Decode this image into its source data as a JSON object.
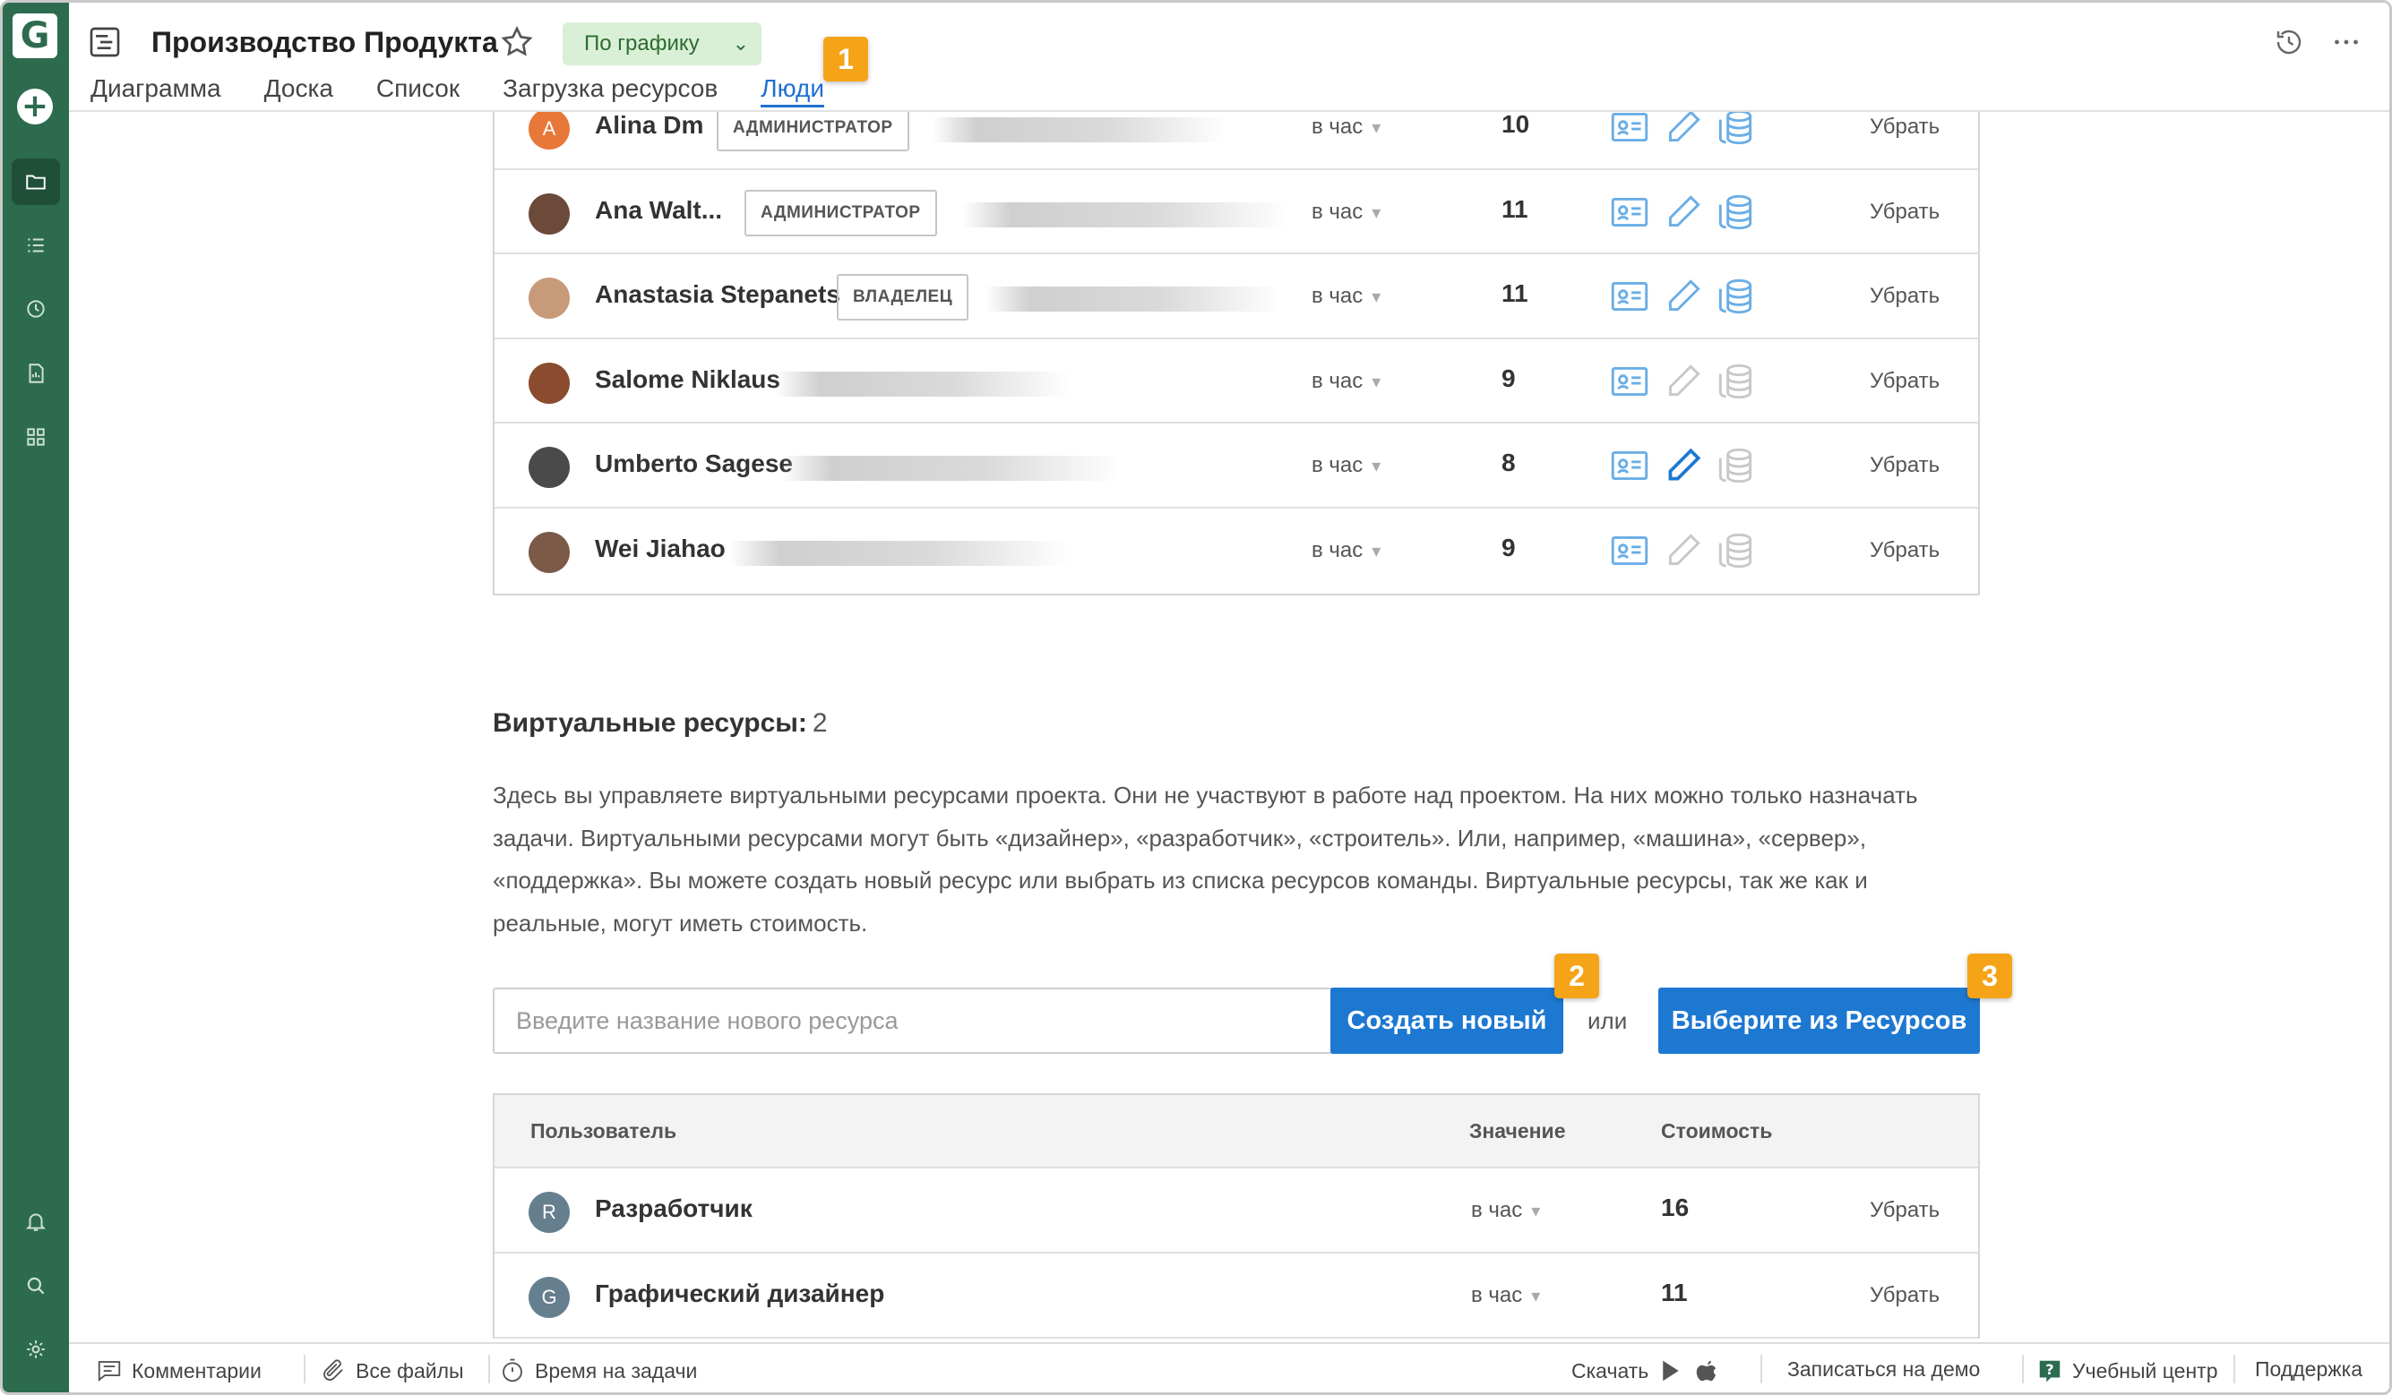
{
  "header": {
    "project_title": "Производство Продукта",
    "status_label": "По графику",
    "tabs": [
      {
        "label": "Диаграмма",
        "active": false
      },
      {
        "label": "Доска",
        "active": false
      },
      {
        "label": "Список",
        "active": false
      },
      {
        "label": "Загрузка ресурсов",
        "active": false
      },
      {
        "label": "Люди",
        "active": true
      }
    ]
  },
  "badges": [
    "1",
    "2",
    "3"
  ],
  "people": [
    {
      "name": "Alina Dm",
      "role": "АДМИНИСТРАТОР",
      "rate": "в час",
      "value": "10",
      "remove": "Убрать",
      "avatar_letter": "A",
      "avatar_color": "#e8773a"
    },
    {
      "name": "Ana Walt...",
      "role": "АДМИНИСТРАТОР",
      "rate": "в час",
      "value": "11",
      "remove": "Убрать",
      "avatar_letter": "",
      "avatar_color": "#6b4a3a"
    },
    {
      "name": "Anastasia Stepanets",
      "role": "ВЛАДЕЛЕЦ",
      "rate": "в час",
      "value": "11",
      "remove": "Убрать",
      "avatar_letter": "",
      "avatar_color": "#c79a7a"
    },
    {
      "name": "Salome Niklaus",
      "role": "",
      "rate": "в час",
      "value": "9",
      "remove": "Убрать",
      "avatar_letter": "",
      "avatar_color": "#8a4b2e"
    },
    {
      "name": "Umberto Sagese",
      "role": "",
      "rate": "в час",
      "value": "8",
      "remove": "Убрать",
      "avatar_letter": "",
      "avatar_color": "#4a4a4a"
    },
    {
      "name": "Wei Jiahao",
      "role": "",
      "rate": "в час",
      "value": "9",
      "remove": "Убрать",
      "avatar_letter": "",
      "avatar_color": "#7b5a48"
    }
  ],
  "virtual": {
    "title": "Виртуальные ресурсы:",
    "count": "2",
    "description": "Здесь вы управляете виртуальными ресурсами проекта. Они не участвуют в работе над проектом. На них можно только назначать задачи. Виртуальными ресурсами могут быть «дизайнер», «разработчик», «строитель». Или, например, «машина», «сервер», «поддержка». Вы можете создать новый ресурс или выбрать из списка ресурсов команды. Виртуальные ресурсы, так же как и реальные, могут иметь стоимость.",
    "input_placeholder": "Введите название нового ресурса",
    "create_button": "Создать новый",
    "or_label": "или",
    "select_button": "Выберите из Ресурсов",
    "columns": {
      "user": "Пользователь",
      "value": "Значение",
      "cost": "Стоимость"
    },
    "rows": [
      {
        "letter": "R",
        "name": "Разработчик",
        "rate": "в час",
        "value": "16",
        "remove": "Убрать"
      },
      {
        "letter": "G",
        "name": "Графический дизайнер",
        "rate": "в час",
        "value": "11",
        "remove": "Убрать"
      }
    ]
  },
  "footer": {
    "comments": "Комментарии",
    "files": "Все файлы",
    "time": "Время на задачи",
    "download": "Скачать",
    "demo": "Записаться на демо",
    "learning": "Учебный центр",
    "support": "Поддержка"
  },
  "colors": {
    "rail": "#2d6b4f",
    "accent": "#1d78d2",
    "badge": "#f5a418",
    "status_bg": "#d9f0d6"
  }
}
